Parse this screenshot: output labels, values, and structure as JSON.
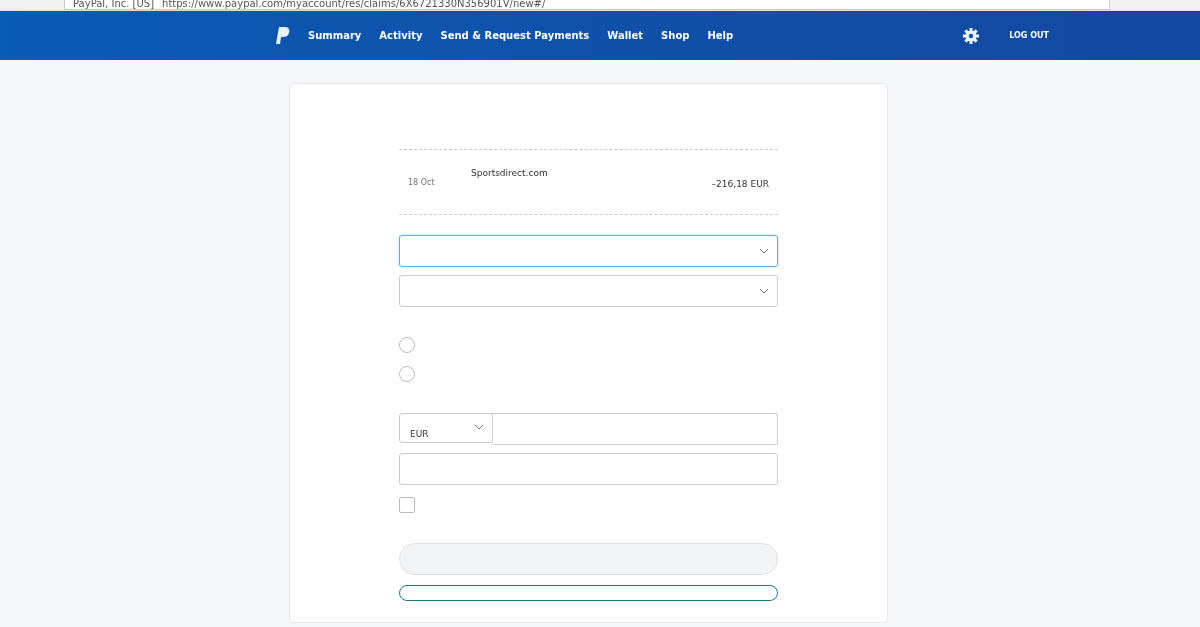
{
  "browser": {
    "site": "PayPal, Inc. [US]",
    "url": "https://www.paypal.com/myaccount/res/claims/6X6721330N356901V/new#/"
  },
  "nav": {
    "items": [
      {
        "label": "Summary"
      },
      {
        "label": "Activity"
      },
      {
        "label": "Send & Request Payments"
      },
      {
        "label": "Wallet"
      },
      {
        "label": "Shop"
      },
      {
        "label": "Help"
      }
    ],
    "logout": "LOG OUT"
  },
  "transaction": {
    "date": "18 Oct",
    "merchant": "Sportsdirect.com",
    "amount": "–216,18 EUR"
  },
  "selects": [
    {
      "focused": true
    },
    {
      "focused": false
    }
  ],
  "radios": [
    {
      "selected": false
    },
    {
      "selected": false
    }
  ],
  "currency": "EUR",
  "checkbox": {
    "checked": false
  }
}
